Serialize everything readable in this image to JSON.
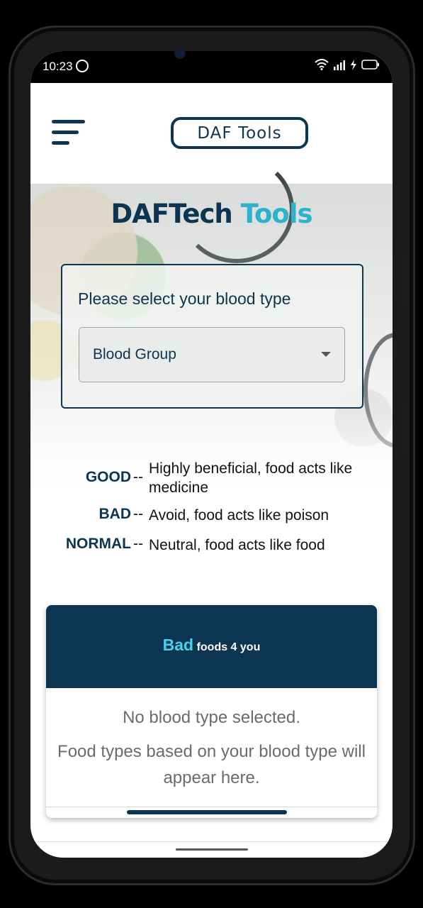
{
  "status_bar": {
    "time": "10:23"
  },
  "app_bar": {
    "logo_text": "DAF Tools"
  },
  "hero": {
    "title_part1": "DAFTech",
    "title_part2": " Tools"
  },
  "selector": {
    "prompt": "Please select your blood type",
    "selected_value": "Blood Group"
  },
  "legend": [
    {
      "key": "GOOD",
      "separator": "--",
      "description": "Highly beneficial, food acts like medicine"
    },
    {
      "key": "BAD",
      "separator": "--",
      "description": "Avoid, food acts like poison"
    },
    {
      "key": "NORMAL",
      "separator": "--",
      "description": "Neutral, food acts like food"
    }
  ],
  "results_card": {
    "title_highlight": "Bad",
    "title_rest": "foods 4 you",
    "empty_message": "No blood type selected.",
    "hint_message": "Food types based on your blood type will appear here."
  },
  "colors": {
    "primary": "#0b3550",
    "accent": "#2bb3cc",
    "accent_light": "#45d2ec"
  }
}
